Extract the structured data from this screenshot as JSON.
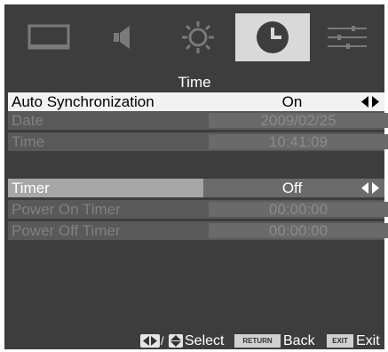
{
  "tabs": [
    {
      "icon": "picture-icon",
      "active": false
    },
    {
      "icon": "speaker-icon",
      "active": false
    },
    {
      "icon": "sun-icon",
      "active": false
    },
    {
      "icon": "clock-icon",
      "active": true
    },
    {
      "icon": "settings-sliders-icon",
      "active": false
    }
  ],
  "page": {
    "title": "Time"
  },
  "rows": {
    "auto_sync": {
      "label": "Auto Synchronization",
      "value": "On"
    },
    "date": {
      "label": "Date",
      "value": "2009/02/25"
    },
    "time": {
      "label": "Time",
      "value": "10:41:09"
    },
    "timer": {
      "label": "Timer",
      "value": "Off"
    },
    "power_on_timer": {
      "label": "Power On Timer",
      "value": "00:00:00"
    },
    "power_off_timer": {
      "label": "Power Off Timer",
      "value": "00:00:00"
    }
  },
  "footer": {
    "select_label": "Select",
    "return_key": "RETURN",
    "back_label": "Back",
    "exit_key": "EXIT",
    "exit_label": "Exit"
  },
  "colors": {
    "background": "#3d3d3d",
    "active_tab": "#d9d9d9",
    "selected_row": "#f2f2f2",
    "highlight_row": "#a6a6a6",
    "disabled_row": "#595959"
  }
}
